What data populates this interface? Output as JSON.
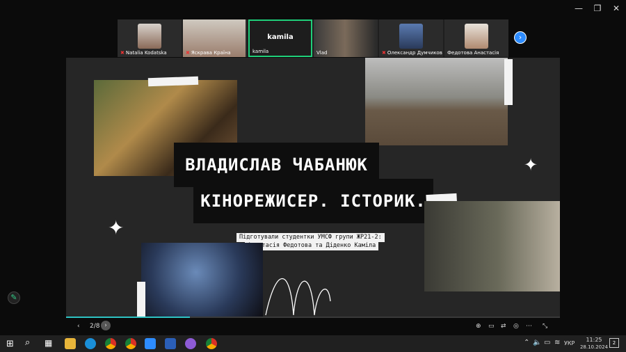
{
  "window": {
    "minimize": "—",
    "restore": "❐",
    "close": "✕"
  },
  "participants": [
    {
      "name": "Natalia Kodatska",
      "muted": true
    },
    {
      "name": "Яскрава Країна",
      "muted": true
    },
    {
      "name": "kamila",
      "muted": false,
      "active": true,
      "display": "kamila"
    },
    {
      "name": "Vlad",
      "muted": false
    },
    {
      "name": "Олександр Думчиков",
      "muted": true
    },
    {
      "name": "Федотова Анастасія",
      "muted": false
    }
  ],
  "slide": {
    "title_line1": "ВЛАДИСЛАВ ЧАБАНЮК",
    "title_line2": "КІНОРЕЖИСЕР. ІСТОРИК.",
    "subtitle_line1": "Підготували студентки УМСФ групи ЖР21-2:",
    "subtitle_line2": "Анастасія Федотова та Діденко Каміла"
  },
  "controls": {
    "prev": "‹",
    "page": "2/8",
    "next": "›",
    "progress": 0.25
  },
  "taskbar": {
    "language": "УКР",
    "time": "11:25",
    "date": "28.10.2024",
    "notifications": "2"
  },
  "colors": {
    "accent": "#2d8cff",
    "active_border": "#1fd07a",
    "progress": "#2ec4c4"
  }
}
